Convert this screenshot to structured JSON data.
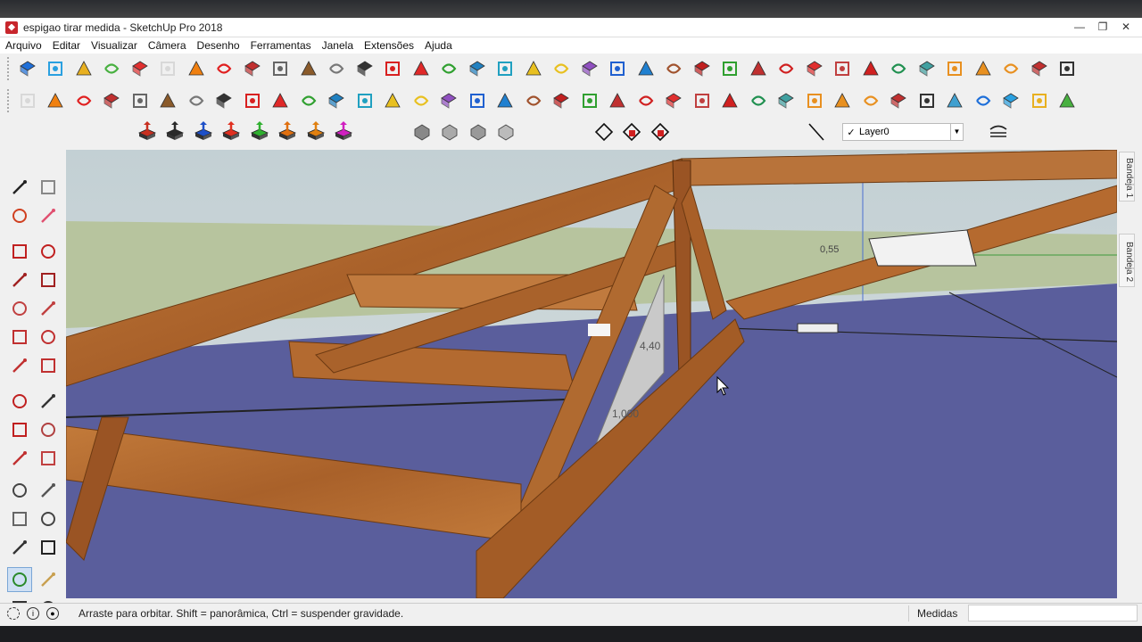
{
  "window": {
    "title": "espigao tirar medida - SketchUp Pro 2018"
  },
  "menu": [
    "Arquivo",
    "Editar",
    "Visualizar",
    "Câmera",
    "Desenho",
    "Ferramentas",
    "Janela",
    "Extensões",
    "Ajuda"
  ],
  "layer": {
    "selected": "Layer0",
    "check": "✓"
  },
  "trays": [
    "Bandeja 1",
    "Bandeja 2"
  ],
  "viewport": {
    "dim_labels": [
      "4,40",
      "1,000",
      "0,55"
    ],
    "colors": {
      "ground": "#5a5e9c",
      "sky": "#c9d4d8",
      "horizon": "#b7c49e",
      "wood": "#b56a2f",
      "wood_dark": "#7a3f14"
    }
  },
  "status": {
    "message": "Arraste para orbitar. Shift = panorâmica, Ctrl = suspender gravidade.",
    "measure_label": "Medidas",
    "measure_value": ""
  },
  "window_buttons": {
    "minimize": "—",
    "restore": "❐",
    "close": "✕"
  }
}
